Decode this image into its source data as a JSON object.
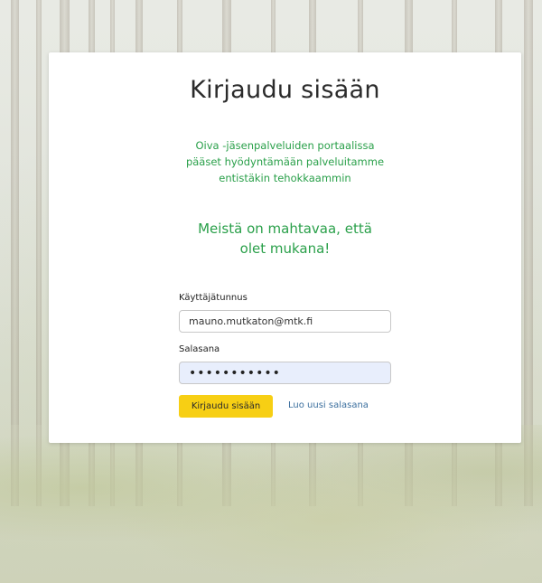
{
  "login": {
    "title": "Kirjaudu sisään",
    "intro_line1": "Oiva -jäsenpalveluiden portaalissa",
    "intro_line2": "pääset hyödyntämään palveluitamme",
    "intro_line3": "entistäkin tehokkaammin",
    "slogan_line1": "Meistä on mahtavaa, että",
    "slogan_line2": "olet mukana!",
    "username_label": "Käyttäjätunnus",
    "username_value": "mauno.mutkaton@mtk.fi",
    "password_label": "Salasana",
    "password_value": "•••••••••••",
    "submit_label": "Kirjaudu sisään",
    "reset_link": "Luo uusi salasana"
  },
  "colors": {
    "accent_green": "#2aa04a",
    "button_yellow": "#f7cf14",
    "link_blue": "#3b6f9e",
    "autofill_blue": "#e8eefc"
  }
}
